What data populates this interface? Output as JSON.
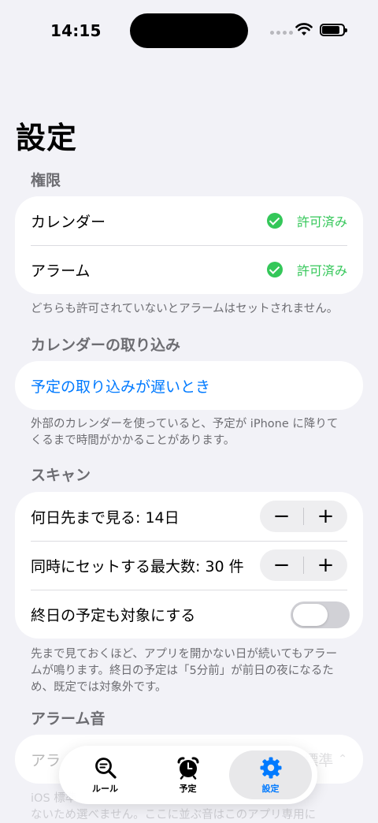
{
  "status_bar": {
    "time": "14:15"
  },
  "title": "設定",
  "permissions": {
    "header": "権限",
    "rows": [
      {
        "label": "カレンダー",
        "status": "許可済み"
      },
      {
        "label": "アラーム",
        "status": "許可済み"
      }
    ],
    "footnote": "どちらも許可されていないとアラームはセットされません。"
  },
  "calendar_import": {
    "header": "カレンダーの取り込み",
    "link": "予定の取り込みが遅いとき",
    "footnote": "外部のカレンダーを使っていると、予定が iPhone に降りてくるまで時間がかかることがあります。"
  },
  "scan": {
    "header": "スキャン",
    "days_ahead": "何日先まで見る: 14日",
    "max_simultaneous": "同時にセットする最大数: 30 件",
    "all_day_label": "終日の予定も対象にする",
    "all_day_enabled": false,
    "minus": "−",
    "plus": "+",
    "footnote": "先まで見ておくほど、アプリを開かない日が続いてもアラームが鳴ります。終日の予定は「5分前」が前日の夜になるため、既定では対象外です。"
  },
  "alarm_sound": {
    "header": "アラーム音",
    "row_label": "アラ",
    "row_value": "標準",
    "footnote_line1": "iOS 標準",
    "footnote_line2": "ないため選べません。ここに並ぶ音はこのアプリ専用に"
  },
  "tabs": [
    {
      "label": "ルール",
      "icon": "search-list-icon",
      "active": false
    },
    {
      "label": "予定",
      "icon": "alarm-clock-icon",
      "active": false
    },
    {
      "label": "設定",
      "icon": "gear-icon",
      "active": true
    }
  ],
  "colors": {
    "accent": "#007aff",
    "granted": "#34c759",
    "background": "#f2f2f7"
  }
}
